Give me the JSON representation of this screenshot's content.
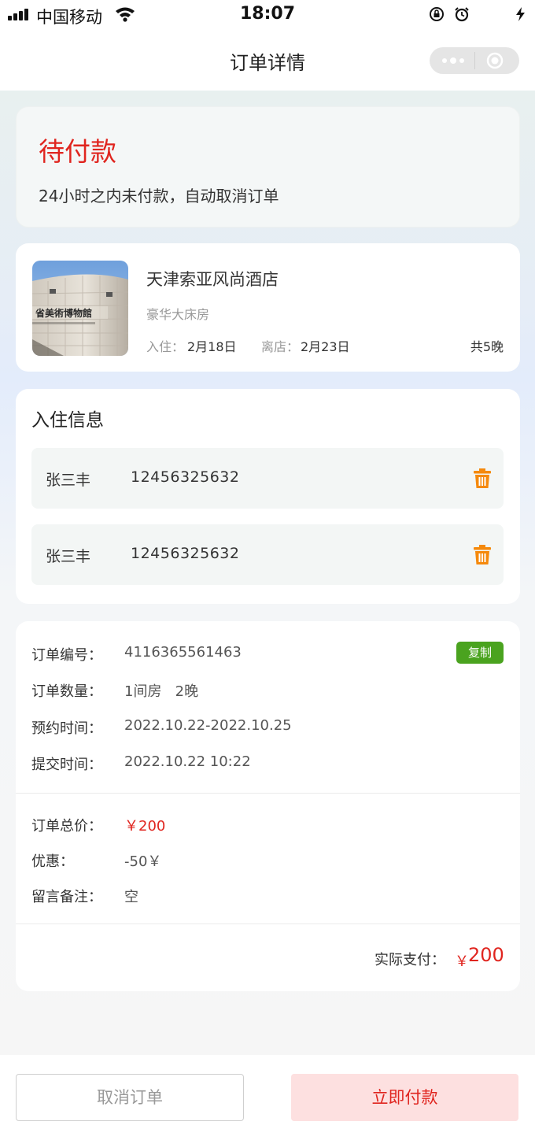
{
  "status_bar": {
    "carrier": "中国移动",
    "time": "18:07"
  },
  "nav": {
    "title": "订单详情"
  },
  "order_status": {
    "title": "待付款",
    "desc": "24小时之内未付款，自动取消订单"
  },
  "hotel": {
    "name": "天津索亚风尚酒店",
    "room_type": "豪华大床房",
    "checkin_label": "入住：",
    "checkin_date": "2月18日",
    "checkout_label": "离店：",
    "checkout_date": "2月23日",
    "nights": "共5晚",
    "image_sign_text": "省美術博物館"
  },
  "guests": {
    "title": "入住信息",
    "list": [
      {
        "name": "张三丰",
        "phone": "12456325632"
      },
      {
        "name": "张三丰",
        "phone": "12456325632"
      }
    ]
  },
  "order": {
    "number_label": "订单编号：",
    "number": "4116365561463",
    "copy_label": "复制",
    "quantity_label": "订单数量：",
    "quantity": "1间房   2晚",
    "reserve_label": "预约时间：",
    "reserve_time": "2022.10.22-2022.10.25",
    "submit_label": "提交时间：",
    "submit_time": "2022.10.22 10:22",
    "total_label": "订单总价：",
    "total": "￥200",
    "discount_label": "优惠：",
    "discount": "-50￥",
    "remark_label": "留言备注：",
    "remark": "空",
    "actual_label": "实际支付：",
    "actual_currency": "￥",
    "actual_amount": "200"
  },
  "actions": {
    "cancel": "取消订单",
    "pay": "立即付款"
  },
  "colors": {
    "accent_red": "#e0251f",
    "copy_green": "#4aa31f",
    "trash_orange": "#f5890c",
    "pay_button_bg": "#fde0e0"
  }
}
